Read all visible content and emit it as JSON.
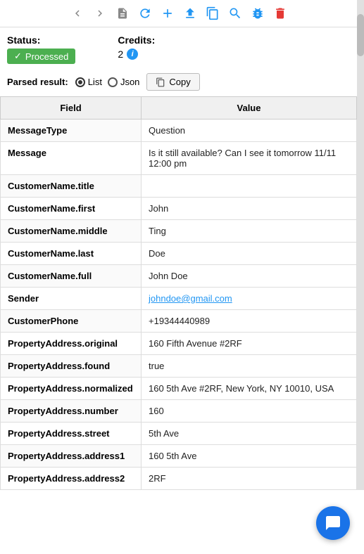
{
  "toolbar": {
    "icons": [
      {
        "name": "back-arrow",
        "symbol": "‹",
        "color": ""
      },
      {
        "name": "forward-arrow",
        "symbol": "›",
        "color": ""
      },
      {
        "name": "document-icon",
        "symbol": "📄",
        "color": ""
      },
      {
        "name": "refresh-icon",
        "symbol": "↻",
        "color": "blue"
      },
      {
        "name": "add-icon",
        "symbol": "+",
        "color": "blue"
      },
      {
        "name": "upload-icon",
        "symbol": "▲",
        "color": "blue"
      },
      {
        "name": "copy-toolbar-icon",
        "symbol": "⧉",
        "color": "blue"
      },
      {
        "name": "search-icon",
        "symbol": "🔍",
        "color": "blue"
      },
      {
        "name": "bug-icon",
        "symbol": "🐛",
        "color": "blue"
      },
      {
        "name": "delete-icon",
        "symbol": "🗑",
        "color": "red"
      }
    ]
  },
  "status": {
    "label": "Status:",
    "badge_text": "Processed",
    "check_mark": "✓"
  },
  "credits": {
    "label": "Credits:",
    "value": "2"
  },
  "parsed_result": {
    "label": "Parsed result:",
    "options": [
      "List",
      "Json"
    ],
    "selected": "List",
    "copy_label": "Copy"
  },
  "table": {
    "headers": [
      "Field",
      "Value"
    ],
    "rows": [
      {
        "field": "MessageType",
        "value": "Question",
        "is_link": false
      },
      {
        "field": "Message",
        "value": "Is it still available? Can I see it tomorrow 11/11 12:00 pm",
        "is_link": false
      },
      {
        "field": "CustomerName.title",
        "value": "",
        "is_link": false
      },
      {
        "field": "CustomerName.first",
        "value": "John",
        "is_link": false
      },
      {
        "field": "CustomerName.middle",
        "value": "Ting",
        "is_link": false
      },
      {
        "field": "CustomerName.last",
        "value": "Doe",
        "is_link": false
      },
      {
        "field": "CustomerName.full",
        "value": "John Doe",
        "is_link": false
      },
      {
        "field": "Sender",
        "value": "johndoe@gmail.com",
        "is_link": true
      },
      {
        "field": "CustomerPhone",
        "value": "+19344440989",
        "is_link": false
      },
      {
        "field": "PropertyAddress.original",
        "value": "160 Fifth Avenue #2RF",
        "is_link": false
      },
      {
        "field": "PropertyAddress.found",
        "value": "true",
        "is_link": false
      },
      {
        "field": "PropertyAddress.normalized",
        "value": "160 5th Ave #2RF, New York, NY 10010, USA",
        "is_link": false
      },
      {
        "field": "PropertyAddress.number",
        "value": "160",
        "is_link": false
      },
      {
        "field": "PropertyAddress.street",
        "value": "5th Ave",
        "is_link": false
      },
      {
        "field": "PropertyAddress.address1",
        "value": "160 5th Ave",
        "is_link": false
      },
      {
        "field": "PropertyAddress.address2",
        "value": "2RF",
        "is_link": false
      }
    ]
  }
}
